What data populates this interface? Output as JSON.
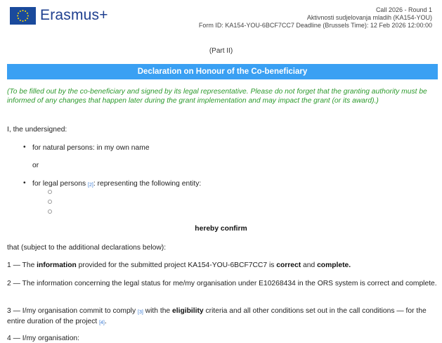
{
  "header": {
    "logo_text": "Erasmus+",
    "call": "Call 2026 - Round 1",
    "action": "Aktivnosti sudjelovanja mladih (KA154-YOU)",
    "form_info": "Form ID: KA154-YOU-6BCF7CC7 Deadline (Brussels Time): 12 Feb 2026 12:00:00"
  },
  "part_label": "(Part II)",
  "banner_title": "Declaration on Honour of the Co-beneficiary",
  "note": "(To be filled out by the co-beneficiary and signed by its legal representative. Please do not forget that the granting authority must be informed of any changes that happen later during the grant implementation and may impact the grant (or its award).)",
  "undersigned": "I, the undersigned:",
  "natural_persons": "for natural persons: in my own name",
  "or_text": "or",
  "legal_persons": "for legal persons",
  "legal_persons_fn": "[2]",
  "legal_persons_rest": ": representing the following entity:",
  "confirm_heading": "hereby confirm",
  "subject_text": "that (subject to the additional declarations below):",
  "decl1": {
    "pre": "1 — The ",
    "bold1": "information",
    "mid": " provided for the submitted project KA154-YOU-6BCF7CC7 is ",
    "bold2": "correct",
    "and": " and ",
    "bold3": "complete."
  },
  "decl2": "2 — The information concerning the legal status for me/my organisation under E10268434 in the ORS system is correct and complete.",
  "decl3": {
    "pre": "3 — I/my organisation commit to comply",
    "fn1": "[3]",
    "mid": " with the ",
    "bold": "eligibility",
    "post": " criteria and all other conditions set out in the call conditions — for the entire duration of the project",
    "fn2": "[4]",
    "end": "."
  },
  "decl4": "4 — I/my organisation:",
  "colors": {
    "banner": "#3aa0f3",
    "note": "#2d9a2d",
    "logo": "#1e3f8f",
    "flag": "#1a4a9c",
    "star": "#ffdd00"
  }
}
